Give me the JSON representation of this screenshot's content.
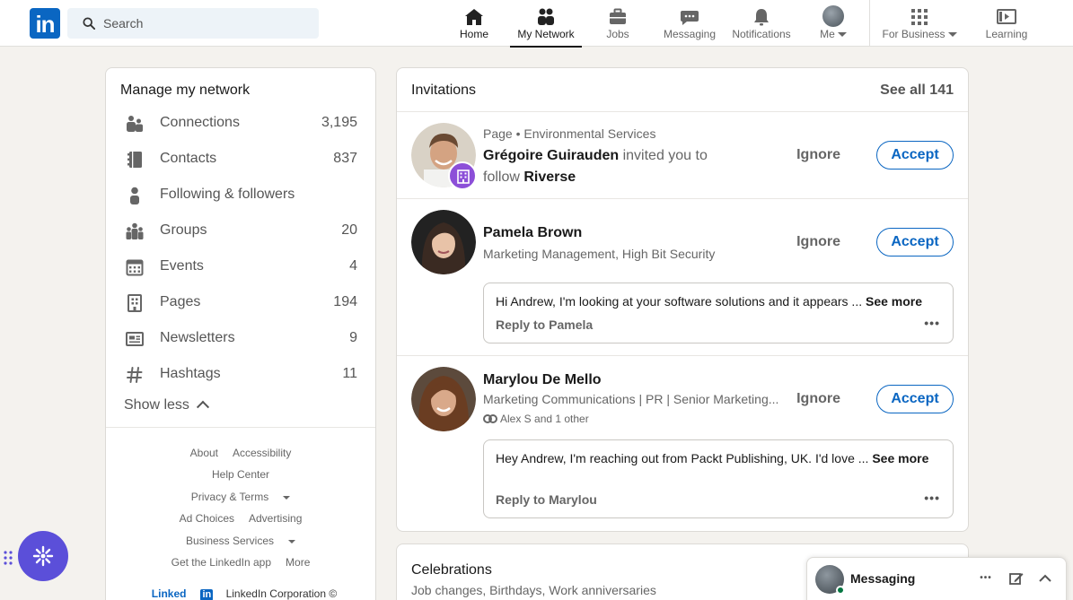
{
  "header": {
    "logo_text": "in",
    "search_placeholder": "Search",
    "nav": {
      "home": "Home",
      "my_network": "My Network",
      "jobs": "Jobs",
      "messaging": "Messaging",
      "notifications": "Notifications",
      "me": "Me",
      "for_business": "For Business",
      "learning": "Learning"
    },
    "active_nav": "my_network"
  },
  "sidebar": {
    "title": "Manage my network",
    "items": [
      {
        "label": "Connections",
        "count": "3,195",
        "icon": "people-icon"
      },
      {
        "label": "Contacts",
        "count": "837",
        "icon": "contacts-book-icon"
      },
      {
        "label": "Following & followers",
        "count": "",
        "icon": "person-icon"
      },
      {
        "label": "Groups",
        "count": "20",
        "icon": "groups-icon"
      },
      {
        "label": "Events",
        "count": "4",
        "icon": "calendar-icon"
      },
      {
        "label": "Pages",
        "count": "194",
        "icon": "building-icon"
      },
      {
        "label": "Newsletters",
        "count": "9",
        "icon": "newsletter-icon"
      },
      {
        "label": "Hashtags",
        "count": "11",
        "icon": "hashtag-icon"
      }
    ],
    "show_less": "Show less",
    "footer": {
      "about": "About",
      "accessibility": "Accessibility",
      "help_center": "Help Center",
      "privacy_terms": "Privacy & Terms",
      "ad_choices": "Ad Choices",
      "advertising": "Advertising",
      "business_services": "Business Services",
      "get_app": "Get the LinkedIn app",
      "more": "More",
      "brand_mark": "Linked",
      "brand_mark_in": "in",
      "copyright": "LinkedIn Corporation ©"
    }
  },
  "invitations": {
    "title": "Invitations",
    "see_all": "See all 141",
    "ignore_label": "Ignore",
    "accept_label": "Accept",
    "items": [
      {
        "meta": "Page • Environmental Services",
        "name": "Grégoire Guirauden",
        "text_mid": " invited you to",
        "text_follow": "follow ",
        "page_name": "Riverse"
      },
      {
        "name": "Pamela Brown",
        "headline": "Marketing Management, High Bit Security",
        "message": "Hi Andrew, I'm looking at your software solutions and it appears ... ",
        "see_more": "See more",
        "reply": "Reply to Pamela"
      },
      {
        "name": "Marylou De Mello",
        "headline": "Marketing Communications | PR | Senior Marketing...",
        "mutual": "Alex S and 1 other",
        "message": "Hey Andrew, I'm reaching out from Packt Publishing, UK. I'd love ... ",
        "see_more": "See more",
        "reply": "Reply to Marylou"
      }
    ]
  },
  "celebrations": {
    "title": "Celebrations",
    "subtitle": "Job changes, Birthdays, Work anniversaries"
  },
  "messaging_bar": {
    "label": "Messaging",
    "dots": "•••"
  },
  "colors": {
    "brand": "#0a66c2",
    "page_badge": "#8c4fd8",
    "fab": "#5b4fd9",
    "online": "#057642"
  }
}
